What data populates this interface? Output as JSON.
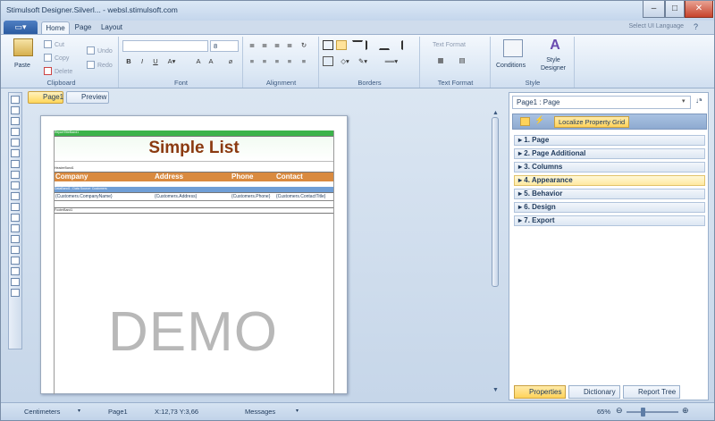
{
  "window": {
    "title": "Stimulsoft Designer.Silverl... - websl.stimulsoft.com"
  },
  "tabs": [
    "Home",
    "Page",
    "Layout"
  ],
  "language": "Select UI Language",
  "clipboard": {
    "paste": "Paste",
    "cut": "Cut",
    "copy": "Copy",
    "delete": "Delete",
    "undo": "Undo",
    "redo": "Redo",
    "label": "Clipboard"
  },
  "font": {
    "size": "8",
    "bold": "B",
    "italic": "I",
    "underline": "U",
    "label": "Font"
  },
  "alignment": {
    "label": "Alignment"
  },
  "borders": {
    "label": "Borders"
  },
  "textformat": {
    "title": "Text Format",
    "label": "Text Format"
  },
  "style": {
    "conditions": "Conditions",
    "style_designer": "Style Designer",
    "label": "Style"
  },
  "pages": [
    "Page1",
    "Preview"
  ],
  "report": {
    "title": "Simple List",
    "report_title_band": "ReportTitleBand1",
    "header_band": "HeaderBand1",
    "data_band": "DataBand1 ; Data Source: Customers",
    "footer_band": "FooterBand1",
    "columns": [
      "Company",
      "Address",
      "Phone",
      "Contact"
    ],
    "fields": [
      "{Customers.CompanyName}",
      "{Customers.Address}",
      "{Customers.Phone}",
      "{Customers.ContactTitle}"
    ],
    "watermark": "DEMO"
  },
  "properties": {
    "selector": "Page1 : Page",
    "localize": "Localize Property Grid",
    "categories": [
      "1. Page",
      "2. Page Additional",
      "3. Columns",
      "4. Appearance",
      "5. Behavior",
      "6. Design",
      "7. Export"
    ],
    "tabs": [
      "Properties",
      "Dictionary",
      "Report Tree"
    ]
  },
  "statusbar": {
    "units": "Centimeters",
    "page": "Page1",
    "coords": "X:12,73  Y:3,66",
    "messages": "Messages",
    "zoom": "65%"
  },
  "colors": {
    "band_green": "#3cb34a",
    "header_orange": "#d98a3f",
    "data_blue": "#6f9ed6",
    "title_brown": "#8b3a10"
  }
}
